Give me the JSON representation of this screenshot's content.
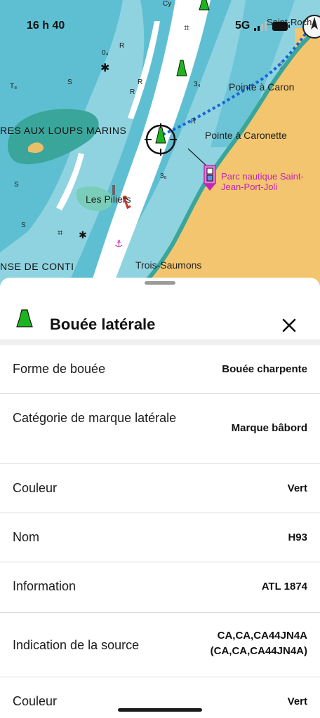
{
  "status_bar": {
    "time": "16 h 40",
    "network": "5G"
  },
  "map": {
    "labels": {
      "saint_roch": "Saint-Roch",
      "pointe_caron": "Pointe à Caron",
      "pointe_caronette": "Pointe à Caronette",
      "islands": "RES AUX LOUPS MARINS",
      "parc_line1": "Parc nautique Saint-",
      "parc_line2": "Jean-Port-Joli",
      "les_piliers": "Les Piliers",
      "trois_saumons": "Trois-Saumons",
      "conti": "NSE DE CONTI"
    },
    "soundings": {
      "s1": "3₄",
      "s2": "3₈",
      "s3": "0₄",
      "s4": "T₈",
      "s5": "R",
      "s6": "S",
      "s7": "R",
      "s8": "R",
      "s9": "R",
      "s10": "S",
      "s11": "S",
      "s12": "Cy"
    }
  },
  "sheet": {
    "title": "Bouée latérale",
    "rows": [
      {
        "label": "Forme de bouée",
        "value": "Bouée charpente"
      },
      {
        "label": "Catégorie de marque latérale",
        "value": "Marque bâbord"
      },
      {
        "label": "Couleur",
        "value": "Vert"
      },
      {
        "label": "Nom",
        "value": "H93"
      },
      {
        "label": "Information",
        "value": "ATL 1874"
      },
      {
        "label": "Indication de la source",
        "value": "CA,CA,CA44JN4A (CA,CA,CA44JN4A)"
      },
      {
        "label": "Couleur",
        "value": "Vert"
      }
    ]
  },
  "icons": {
    "buoy": "lateral-buoy-icon",
    "close": "close-icon",
    "compass": "compass-icon"
  },
  "colors": {
    "land": "#f3c56e",
    "deep_water": "#ffffff",
    "shallow_water": "#8fd3e0",
    "mid_water": "#5fbfd2",
    "drying": "#3aa69b",
    "buoy_green": "#1db51d",
    "route": "#1565d8",
    "park_magenta": "#c026b5"
  }
}
